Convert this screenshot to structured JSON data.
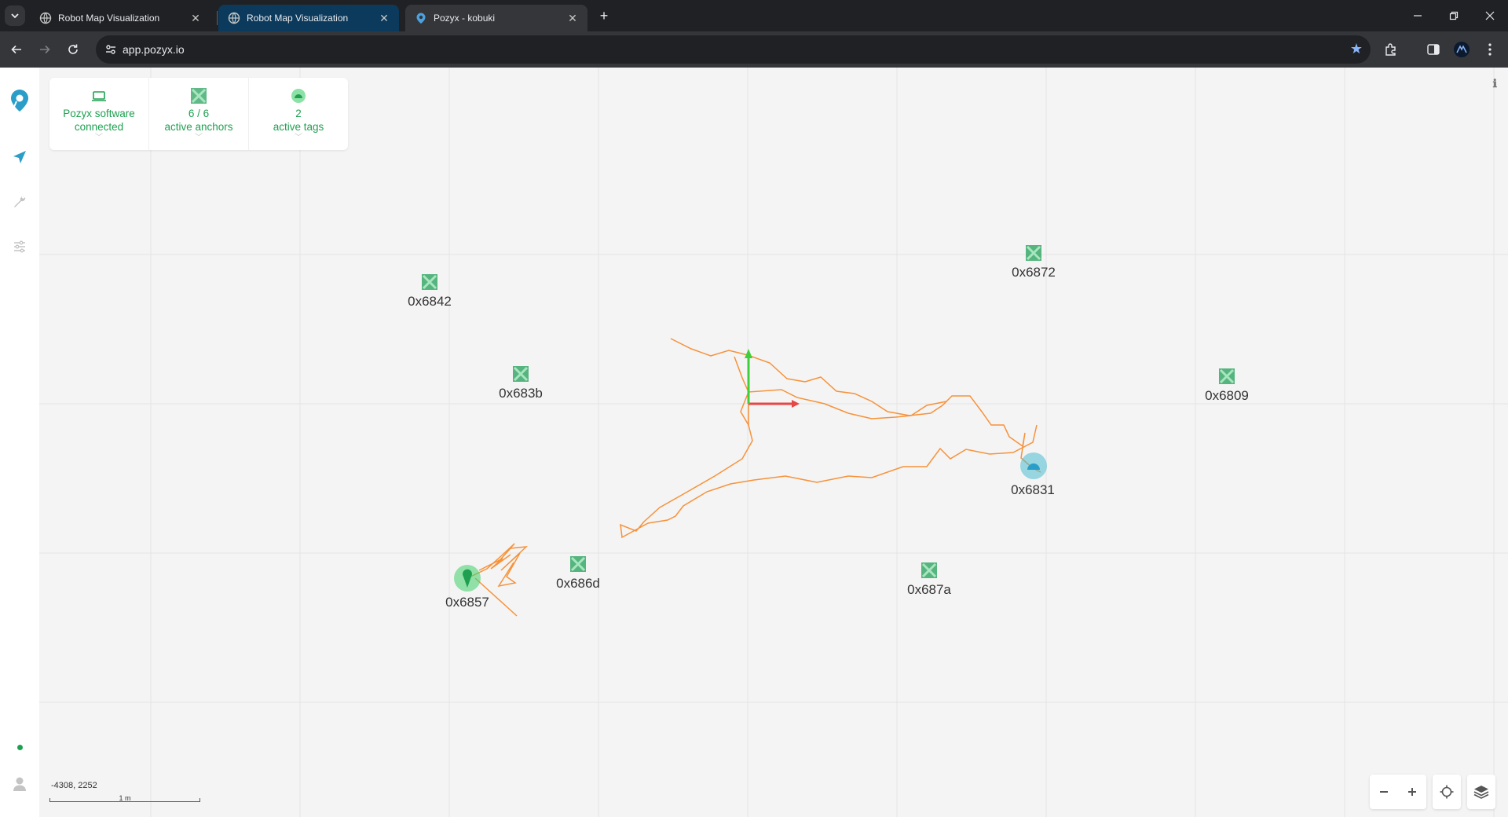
{
  "browser": {
    "tabs": [
      {
        "title": "Robot Map Visualization",
        "active": false
      },
      {
        "title": "Robot Map Visualization",
        "active": false,
        "highlighted": true
      },
      {
        "title": "Pozyx - kobuki",
        "active": true
      }
    ],
    "url": "app.pozyx.io"
  },
  "status": {
    "software": {
      "line1": "Pozyx software",
      "line2": "connected"
    },
    "anchors": {
      "line1": "6 / 6",
      "line2": "active anchors"
    },
    "tags": {
      "line1": "2",
      "line2": "active tags"
    }
  },
  "map": {
    "anchors": [
      {
        "id": "0x6842"
      },
      {
        "id": "0x683b"
      },
      {
        "id": "0x6872"
      },
      {
        "id": "0x6809"
      },
      {
        "id": "0x686d"
      },
      {
        "id": "0x687a"
      }
    ],
    "tags": [
      {
        "id": "0x6831",
        "color": "#4bbcd0"
      },
      {
        "id": "0x6857",
        "color": "#3fcf6a"
      }
    ],
    "cursor_coords": "-4308, 2252",
    "scale_label": "1 m",
    "colors": {
      "anchor": "#3aa86a",
      "trail": "#f7923a",
      "axis_x": "#e84545",
      "axis_y": "#3fcf3a",
      "accent": "#1ea050"
    }
  }
}
